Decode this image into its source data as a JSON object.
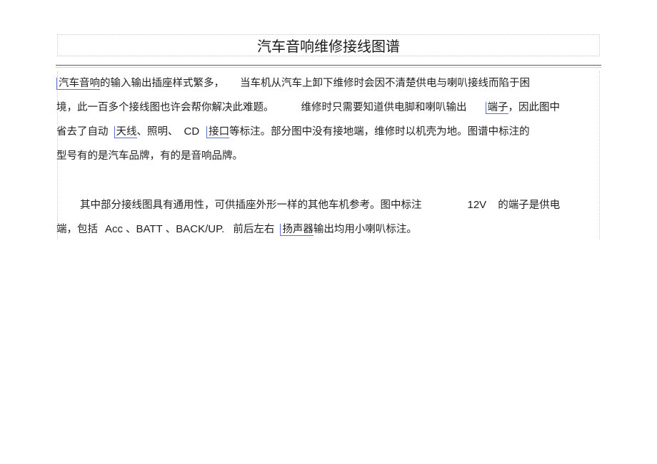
{
  "document": {
    "title": "汽车音响维修接线图谱",
    "paragraph1": {
      "line1": {
        "link": "汽车音响",
        "text_a": "的输入输出插座样式繁多，",
        "text_b": "当车机从汽车上卸下维修时会因不清楚供电与喇叭接线而陷于困"
      },
      "line2": {
        "text_a": "境，此一百多个接线图也许会帮你解决此难题。",
        "text_b": "维修时只需要知道供电脚和喇叭输出",
        "link": "端子",
        "text_c": "，因此图中"
      },
      "line3": {
        "text_a": "省去了自动",
        "link_a": "天线",
        "text_b": "、照明、",
        "text_cd": "CD",
        "link_b": "接口",
        "text_c": "等标注。部分图中没有接地端，维修时以机壳为地。图谱中标注的"
      },
      "line4": {
        "text_a": "型号有的是汽车品牌，有的是音响品牌。"
      }
    },
    "paragraph2": {
      "line1": {
        "text_a": "其中部分接线图具有通用性，可供插座外形一样的其他车机参考。图中标注",
        "text_12v": "12V",
        "text_b": "的端子是供电"
      },
      "line2": {
        "text_a": "端，包括",
        "text_acc": "Acc",
        "sep1": "、",
        "text_batt": "BATT",
        "sep2": "、",
        "text_backup": "BACK/UP.",
        "text_b": "前后左右",
        "link": "扬声器",
        "text_c": "输出均用小喇叭标注。"
      }
    }
  }
}
